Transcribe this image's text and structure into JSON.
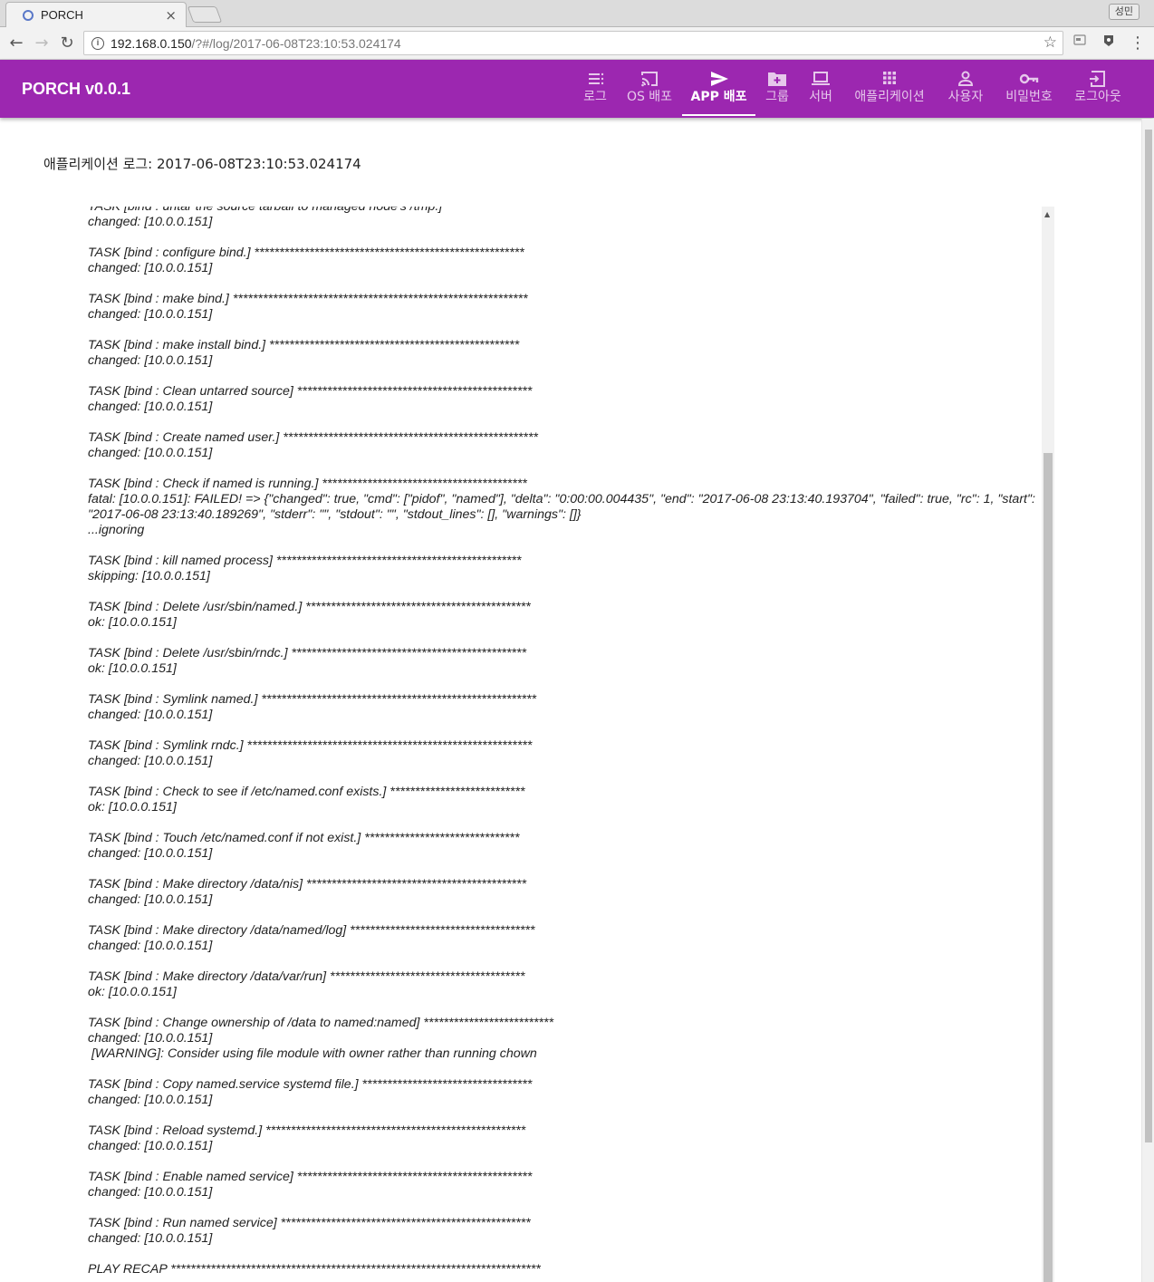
{
  "browser": {
    "tab_title": "PORCH",
    "tab_close": "×",
    "profile_label": "성민",
    "url_host": "192.168.0.150",
    "url_path": "/?#/log/2017-06-08T23:10:53.024174",
    "back_icon": "←",
    "forward_icon": "→",
    "reload_icon": "↻",
    "star_icon": "☆",
    "menu_icon": "⋮"
  },
  "app": {
    "brand": "PORCH v0.0.1",
    "accent_color": "#9c27b0",
    "nav": [
      {
        "label": "로그",
        "icon": "list-icon",
        "active": false
      },
      {
        "label": "OS 배포",
        "icon": "cast-icon",
        "active": false
      },
      {
        "label": "APP 배포",
        "icon": "send-icon",
        "active": true
      },
      {
        "label": "그룹",
        "icon": "folder-add-icon",
        "active": false
      },
      {
        "label": "서버",
        "icon": "laptop-icon",
        "active": false
      },
      {
        "label": "애플리케이션",
        "icon": "apps-grid-icon",
        "active": false
      },
      {
        "label": "사용자",
        "icon": "person-icon",
        "active": false
      },
      {
        "label": "비밀번호",
        "icon": "key-icon",
        "active": false
      },
      {
        "label": "로그아웃",
        "icon": "exit-icon",
        "active": false
      }
    ]
  },
  "page": {
    "title": "애플리케이션 로그: 2017-06-08T23:10:53.024174"
  },
  "log_entries": [
    [
      "TASK [bind : untar the source tarball to managed node's /tmp.] *****************",
      "changed: [10.0.0.151]"
    ],
    [
      "TASK [bind : configure bind.] ******************************************************",
      "changed: [10.0.0.151]"
    ],
    [
      "TASK [bind : make bind.] ***********************************************************",
      "changed: [10.0.0.151]"
    ],
    [
      "TASK [bind : make install bind.] **************************************************",
      "changed: [10.0.0.151]"
    ],
    [
      "TASK [bind : Clean untarred source] ***********************************************",
      "changed: [10.0.0.151]"
    ],
    [
      "TASK [bind : Create named user.] ***************************************************",
      "changed: [10.0.0.151]"
    ],
    [
      "TASK [bind : Check if named is running.] *****************************************",
      "fatal: [10.0.0.151]: FAILED! => {\"changed\": true, \"cmd\": [\"pidof\", \"named\"], \"delta\": \"0:00:00.004435\", \"end\": \"2017-06-08 23:13:40.193704\", \"failed\": true, \"rc\": 1, \"start\": \"2017-06-08 23:13:40.189269\", \"stderr\": \"\", \"stdout\": \"\", \"stdout_lines\": [], \"warnings\": []}",
      "...ignoring"
    ],
    [
      "TASK [bind : kill named process] *************************************************",
      "skipping: [10.0.0.151]"
    ],
    [
      "TASK [bind : Delete /usr/sbin/named.] *********************************************",
      "ok: [10.0.0.151]"
    ],
    [
      "TASK [bind : Delete /usr/sbin/rndc.] ***********************************************",
      "ok: [10.0.0.151]"
    ],
    [
      "TASK [bind : Symlink named.] *******************************************************",
      "changed: [10.0.0.151]"
    ],
    [
      "TASK [bind : Symlink rndc.] *********************************************************",
      "changed: [10.0.0.151]"
    ],
    [
      "TASK [bind : Check to see if /etc/named.conf exists.] ***************************",
      "ok: [10.0.0.151]"
    ],
    [
      "TASK [bind : Touch /etc/named.conf if not exist.] *******************************",
      "changed: [10.0.0.151]"
    ],
    [
      "TASK [bind : Make directory /data/nis] ********************************************",
      "changed: [10.0.0.151]"
    ],
    [
      "TASK [bind : Make directory /data/named/log] *************************************",
      "changed: [10.0.0.151]"
    ],
    [
      "TASK [bind : Make directory /data/var/run] ***************************************",
      "ok: [10.0.0.151]"
    ],
    [
      "TASK [bind : Change ownership of /data to named:named] **************************",
      "changed: [10.0.0.151]",
      " [WARNING]: Consider using file module with owner rather than running chown"
    ],
    [
      "TASK [bind : Copy named.service systemd file.] **********************************",
      "changed: [10.0.0.151]"
    ],
    [
      "TASK [bind : Reload systemd.] ****************************************************",
      "changed: [10.0.0.151]"
    ],
    [
      "TASK [bind : Enable named service] ***********************************************",
      "changed: [10.0.0.151]"
    ],
    [
      "TASK [bind : Run named service] **************************************************",
      "changed: [10.0.0.151]"
    ],
    [
      "PLAY RECAP **************************************************************************"
    ]
  ]
}
